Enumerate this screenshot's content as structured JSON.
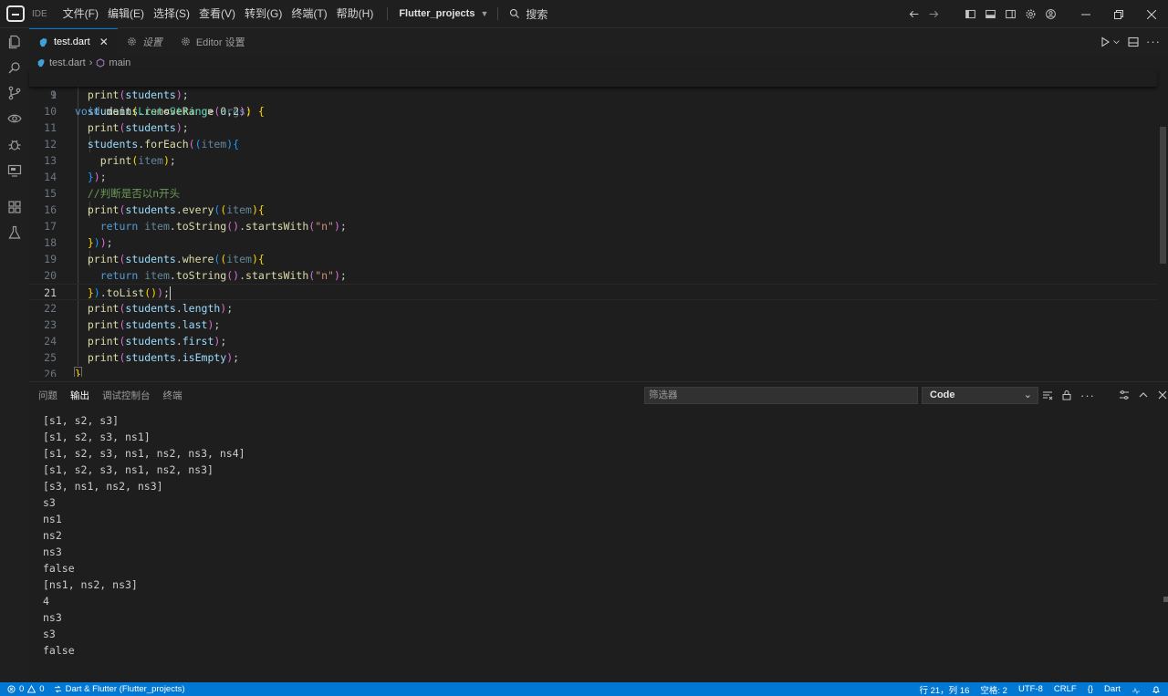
{
  "title_bar": {
    "ide_badge": "IDE",
    "menu": [
      "文件(F)",
      "编辑(E)",
      "选择(S)",
      "查看(V)",
      "转到(G)",
      "终端(T)",
      "帮助(H)"
    ],
    "project": "Flutter_projects",
    "search_label": "搜索"
  },
  "tabs": [
    {
      "label": "test.dart",
      "active": true
    },
    {
      "label": "设置",
      "active": false
    },
    {
      "label": "Editor 设置",
      "active": false
    }
  ],
  "breadcrumb": {
    "file": "test.dart",
    "symbol": "main"
  },
  "editor": {
    "cursor_line": 21,
    "lines": [
      {
        "n": "1",
        "code": "void main(List<String> args) {"
      },
      {
        "n": "9",
        "code": "  print(students);"
      },
      {
        "n": "10",
        "code": "  students.removeRange(0,2);"
      },
      {
        "n": "11",
        "code": "  print(students);"
      },
      {
        "n": "12",
        "code": "  students.forEach((item){"
      },
      {
        "n": "13",
        "code": "    print(item);"
      },
      {
        "n": "14",
        "code": "  });"
      },
      {
        "n": "15",
        "code": "  //判断是否以n开头"
      },
      {
        "n": "16",
        "code": "  print(students.every((item){"
      },
      {
        "n": "17",
        "code": "    return item.toString().startsWith(\"n\");"
      },
      {
        "n": "18",
        "code": "  }));"
      },
      {
        "n": "19",
        "code": "  print(students.where((item){"
      },
      {
        "n": "20",
        "code": "    return item.toString().startsWith(\"n\");"
      },
      {
        "n": "21",
        "code": "  }).toList());"
      },
      {
        "n": "22",
        "code": "  print(students.length);"
      },
      {
        "n": "23",
        "code": "  print(students.last);"
      },
      {
        "n": "24",
        "code": "  print(students.first);"
      },
      {
        "n": "25",
        "code": "  print(students.isEmpty);"
      },
      {
        "n": "26",
        "code": "}"
      }
    ]
  },
  "panel": {
    "tabs": [
      "问题",
      "输出",
      "调试控制台",
      "终端"
    ],
    "active_tab": "输出",
    "filter_placeholder": "筛选器",
    "channel": "Code",
    "output_lines": [
      "[s1, s2, s3]",
      "[s1, s2, s3, ns1]",
      "[s1, s2, s3, ns1, ns2, ns3, ns4]",
      "[s1, s2, s3, ns1, ns2, ns3]",
      "[s3, ns1, ns2, ns3]",
      "s3",
      "ns1",
      "ns2",
      "ns3",
      "false",
      "[ns1, ns2, ns3]",
      "4",
      "ns3",
      "s3",
      "false"
    ]
  },
  "status_bar": {
    "errors": "0",
    "warnings": "0",
    "remote": "Dart & Flutter (Flutter_projects)",
    "position": "行 21，列 16",
    "spaces": "空格: 2",
    "encoding": "UTF-8",
    "eol": "CRLF",
    "braces": "{}",
    "language": "Dart",
    "accent_color": "#0078d4"
  }
}
